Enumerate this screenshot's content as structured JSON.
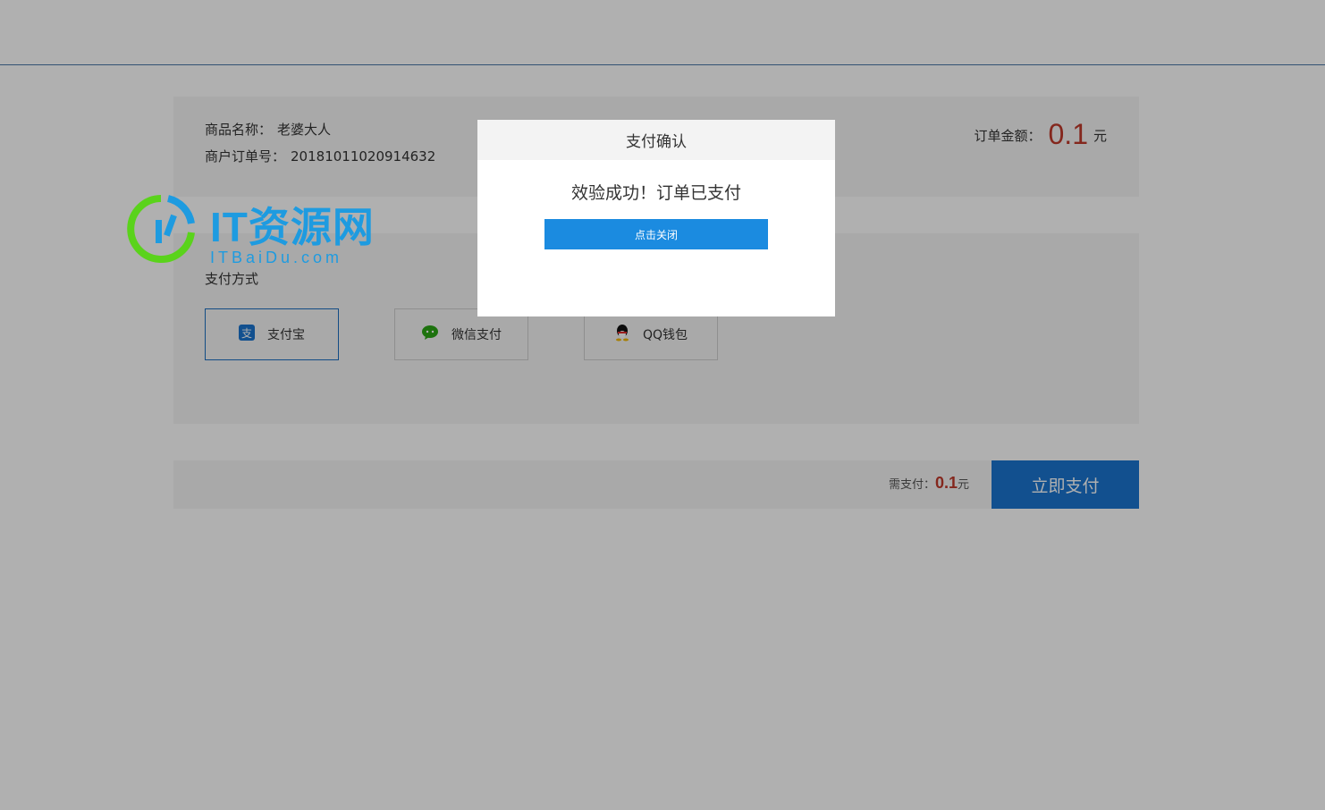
{
  "order": {
    "product_label": "商品名称：",
    "product_name": "老婆大人",
    "order_no_label": "商户订单号：",
    "order_no": "20181011020914632",
    "amount_label": "订单金额：",
    "amount_value": "0.1",
    "amount_unit": "元"
  },
  "payment": {
    "title": "支付方式",
    "methods": [
      {
        "label": "支付宝",
        "icon": "alipay-icon",
        "selected": true
      },
      {
        "label": "微信支付",
        "icon": "wechat-icon",
        "selected": false
      },
      {
        "label": "QQ钱包",
        "icon": "qq-icon",
        "selected": false
      }
    ]
  },
  "footer": {
    "need_label": "需支付：",
    "need_value": "0.1",
    "need_unit": "元",
    "pay_button": "立即支付"
  },
  "watermark": {
    "title": "IT资源网",
    "subtitle": "ITBaiDu.com"
  },
  "modal": {
    "title": "支付确认",
    "message": "效验成功！订单已支付",
    "close_button": "点击关闭"
  },
  "colors": {
    "accent": "#1b75d0",
    "price": "#c0392b",
    "watermark_blue": "#1e9be0",
    "watermark_green": "#5ad31b"
  }
}
